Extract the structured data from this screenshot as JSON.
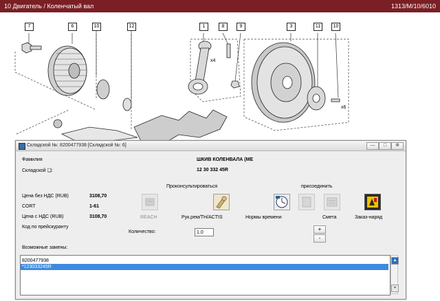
{
  "titlebar": {
    "left": "10 Двигатель / Коленчатый вал",
    "right": "1313/M/10/6010"
  },
  "diagram": {
    "callouts": [
      {
        "label": "7"
      },
      {
        "label": "6"
      },
      {
        "label": "10"
      },
      {
        "label": "12"
      },
      {
        "label": "1"
      },
      {
        "label": "8"
      },
      {
        "label": "9"
      },
      {
        "label": "3"
      },
      {
        "label": "11"
      },
      {
        "label": "10"
      }
    ],
    "annotations": [
      "x4",
      "x6"
    ]
  },
  "dialog": {
    "title": "Складской №: 8200477938 [Складской №: 6]",
    "window_buttons": {
      "minimize": "—",
      "maximize": "□",
      "close": "⊗"
    },
    "family_label": "Фамилия",
    "family_value": "ШКИВ КОЛЕНВАЛА (МЕ",
    "stock_label": "Складской ❏:",
    "stock_value": "12 30 332 45R",
    "consult_heading": "Проконсультироваться",
    "attach_heading": "присоединить",
    "price_rows": [
      {
        "label": "Цена без НДС (RUB)",
        "value": "3108,70"
      },
      {
        "label": "CORT",
        "value": "1-61"
      },
      {
        "label": "Цена с НДС (RUB)",
        "value": "3108,70"
      }
    ],
    "actions": [
      {
        "label": "REACH",
        "icon": "reach-icon",
        "enabled": false
      },
      {
        "label": "Рук.рем/TH/ACTIS",
        "icon": "repair-manual-icon",
        "enabled": true
      },
      {
        "label": "Нормы времени",
        "icon": "labor-time-icon",
        "enabled": true
      },
      {
        "label": "Смета",
        "icon": "estimate-icon",
        "enabled": false
      },
      {
        "label": "Заказ-наряд",
        "icon": "work-order-icon",
        "enabled": true
      }
    ],
    "pricelist_code_label": "Код по прейскуранту",
    "quantity_label": "Количество:",
    "quantity_value": "1.0",
    "spin_plus": "+",
    "spin_minus": "-",
    "replacements_label": "Возможные замены:",
    "replacements": [
      "8200477938",
      "*123033245R"
    ],
    "selected_replacement": 1,
    "colors": {
      "header_bg": "#7a1f24",
      "selection": "#3d8ae0"
    }
  }
}
